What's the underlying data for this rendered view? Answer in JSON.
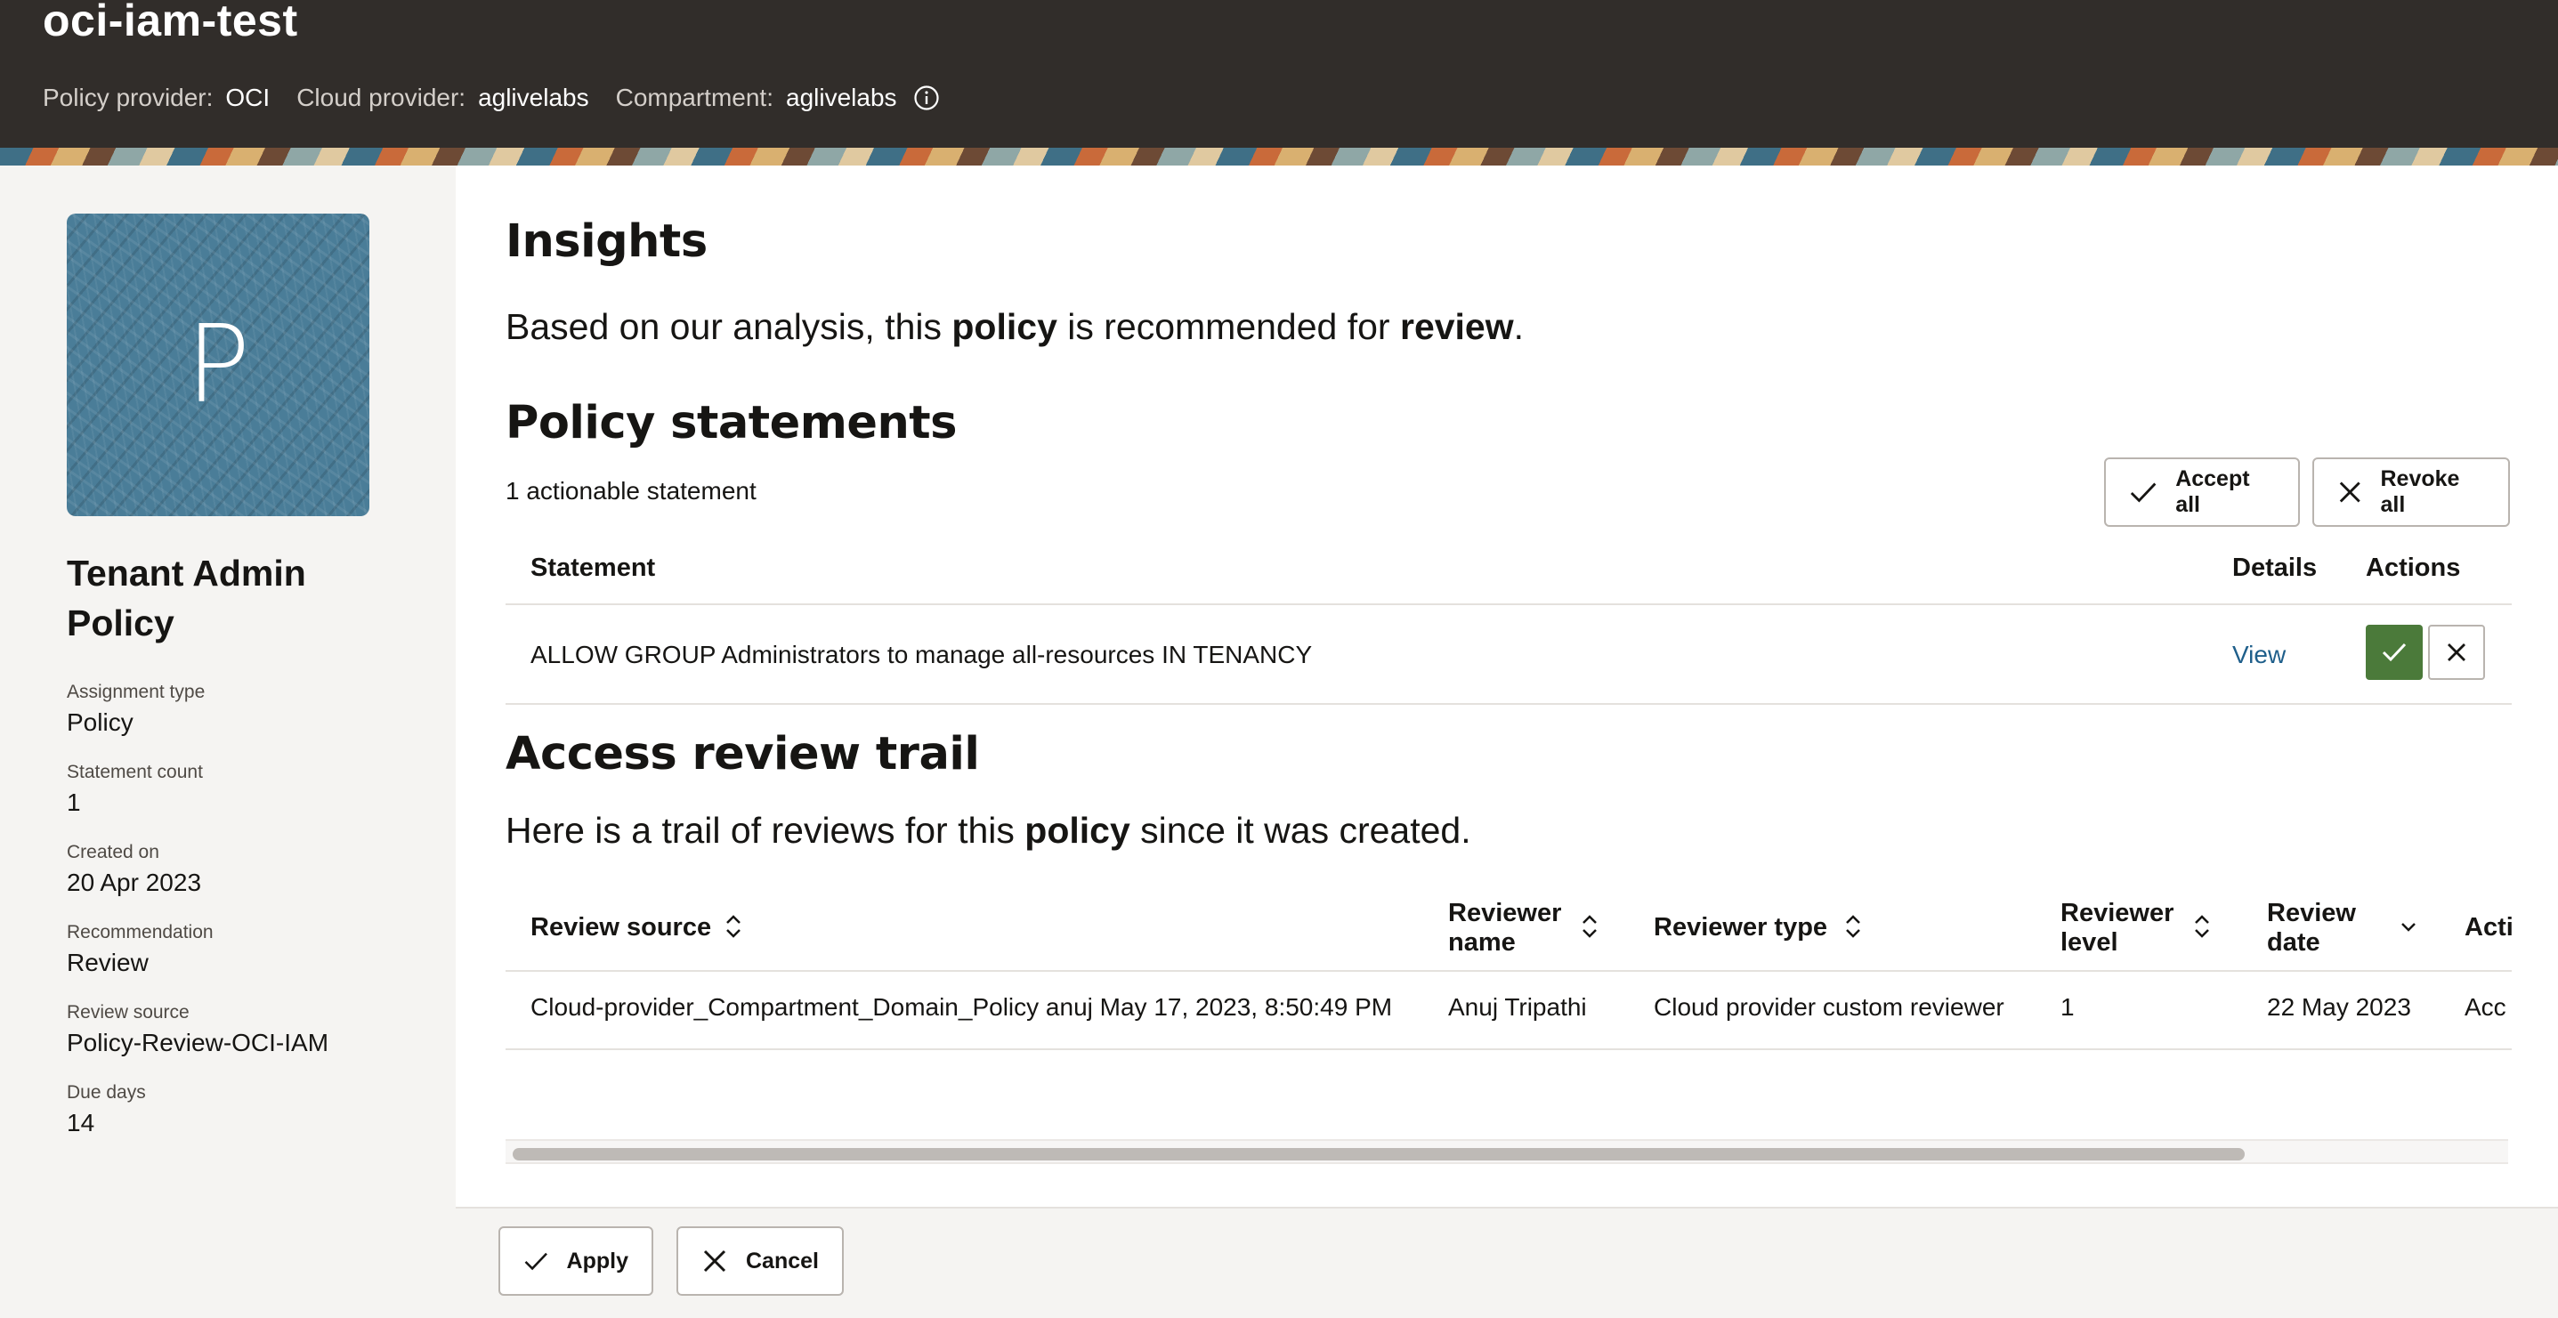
{
  "header": {
    "title": "oci-iam-test",
    "policy_provider_label": "Policy provider:",
    "policy_provider_value": "OCI",
    "cloud_provider_label": "Cloud provider:",
    "cloud_provider_value": "aglivelabs",
    "compartment_label": "Compartment:",
    "compartment_value": "aglivelabs"
  },
  "sidebar": {
    "avatar_letter": "P",
    "policy_name": "Tenant Admin Policy",
    "fields": [
      {
        "label": "Assignment type",
        "value": "Policy"
      },
      {
        "label": "Statement count",
        "value": "1"
      },
      {
        "label": "Created on",
        "value": "20 Apr 2023"
      },
      {
        "label": "Recommendation",
        "value": "Review"
      },
      {
        "label": "Review source",
        "value": "Policy-Review-OCI-IAM"
      },
      {
        "label": "Due days",
        "value": "14"
      }
    ]
  },
  "insights": {
    "heading": "Insights",
    "text_before": "Based on our analysis, this ",
    "text_bold1": "policy",
    "text_middle": " is recommended for ",
    "text_bold2": "review",
    "text_after": "."
  },
  "statements": {
    "heading": "Policy statements",
    "count_text": "1 actionable statement",
    "accept_all_label": "Accept all",
    "revoke_all_label": "Revoke all",
    "columns": {
      "statement": "Statement",
      "details": "Details",
      "actions": "Actions"
    },
    "rows": [
      {
        "statement": "ALLOW GROUP Administrators to manage all-resources IN TENANCY",
        "details": "View"
      }
    ]
  },
  "trail": {
    "heading": "Access review trail",
    "text_before": "Here is a trail of reviews for this ",
    "text_bold": "policy",
    "text_after": " since it was created.",
    "columns": {
      "source": "Review source",
      "name_line1": "Reviewer",
      "name_line2": "name",
      "type": "Reviewer type",
      "level_line1": "Reviewer",
      "level_line2": "level",
      "date_line1": "Review",
      "date_line2": "date",
      "action": "Acti"
    },
    "rows": [
      {
        "source": "Cloud-provider_Compartment_Domain_Policy anuj May 17, 2023, 8:50:49 PM",
        "name": "Anuj Tripathi",
        "type": "Cloud provider custom reviewer",
        "level": "1",
        "date": "22 May 2023",
        "action": "Acc"
      }
    ]
  },
  "footer": {
    "apply_label": "Apply",
    "cancel_label": "Cancel"
  },
  "colors": {
    "header_bg": "#312d2a",
    "accept_green": "#4b7a3a",
    "link_blue": "#1f5f8b"
  }
}
